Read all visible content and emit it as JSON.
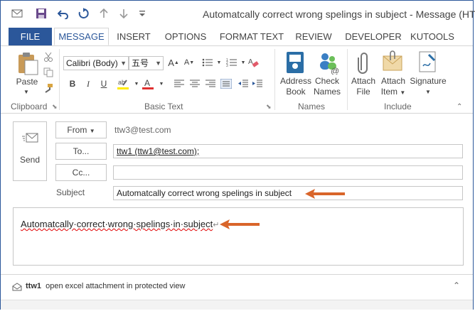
{
  "window": {
    "title": "Automatcally correct wrong spelings in subject - Message (HTML)",
    "controls": {
      "help": "?",
      "restore": "▢",
      "minimize": "–",
      "maximize": "□",
      "close": "✕"
    }
  },
  "quick_access": {
    "icons": [
      "envelope-icon",
      "save-icon",
      "undo-icon",
      "redo-icon",
      "up-arrow-icon",
      "down-arrow-icon",
      "customize-dropdown-icon"
    ]
  },
  "tabs": [
    {
      "label": "FILE"
    },
    {
      "label": "MESSAGE"
    },
    {
      "label": "INSERT"
    },
    {
      "label": "OPTIONS"
    },
    {
      "label": "FORMAT TEXT"
    },
    {
      "label": "REVIEW"
    },
    {
      "label": "DEVELOPER"
    },
    {
      "label": "KUTOOLS"
    }
  ],
  "ribbon": {
    "clipboard": {
      "group_label": "Clipboard",
      "paste_label": "Paste"
    },
    "basic_text": {
      "group_label": "Basic Text",
      "font_name": "Calibri (Body)",
      "font_size": "五号"
    },
    "names": {
      "group_label": "Names",
      "address_book_line1": "Address",
      "address_book_line2": "Book",
      "check_names_line1": "Check",
      "check_names_line2": "Names"
    },
    "include": {
      "group_label": "Include",
      "attach_file_line1": "Attach",
      "attach_file_line2": "File",
      "attach_item_line1": "Attach",
      "attach_item_line2": "Item",
      "signature_label": "Signature"
    }
  },
  "compose": {
    "send_label": "Send",
    "from_button": "From",
    "from_value": "ttw3@test.com",
    "to_button": "To...",
    "to_value": "ttw1 (ttw1@test.com);",
    "cc_button": "Cc...",
    "cc_value": "",
    "subject_label": "Subject",
    "subject_value": "Automatcally correct wrong spelings in subject",
    "body_text": "Automatcally·correct·wrong·spelings·in·subject"
  },
  "people_pane": {
    "name": "ttw1",
    "message": "open excel attachment in protected view"
  },
  "colors": {
    "accent": "#2b579a",
    "arrow": "#d9652a",
    "spelling_underline": "#e00000"
  }
}
